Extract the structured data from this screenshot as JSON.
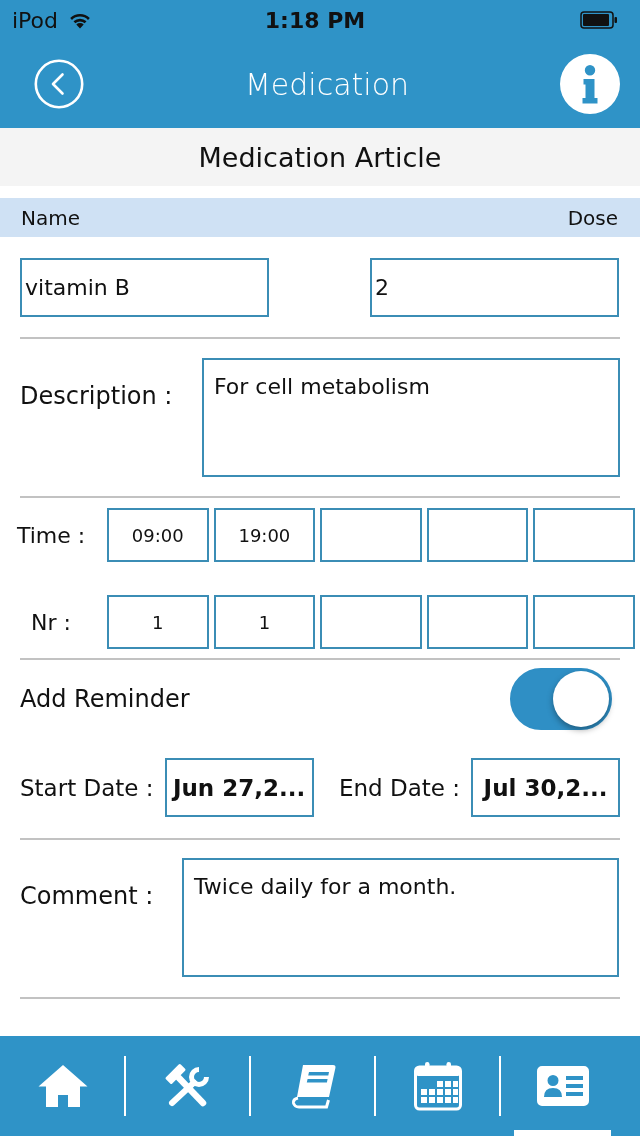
{
  "status_bar": {
    "carrier": "iPod",
    "time": "1:18 PM"
  },
  "nav_bar": {
    "title": "Medication"
  },
  "section": {
    "title": "Medication Article"
  },
  "columns": [
    "Name",
    "Dose"
  ],
  "medication": {
    "name": "vitamin B",
    "dose": "2"
  },
  "description": {
    "label": "Description :",
    "value": "For cell metabolism"
  },
  "schedule": [
    {
      "label": "Time :",
      "cells": [
        {
          "value": "09:00"
        },
        {
          "value": "19:00"
        },
        {},
        {},
        {}
      ]
    },
    {
      "label": "Nr :",
      "cells": [
        {
          "value": "1"
        },
        {
          "value": "1"
        },
        {},
        {},
        {}
      ]
    }
  ],
  "reminder": {
    "label": "Add Reminder",
    "on": true
  },
  "dates": [
    {
      "label": "Start Date :",
      "value": "Jun 27,2..."
    },
    {
      "label": "End Date :",
      "value": "Jul 30,2..."
    }
  ],
  "comment": {
    "label": "Comment :",
    "value": "Twice daily for a month."
  },
  "tab_bar": {
    "tabs": [
      {
        "kind": "home",
        "selected": false
      },
      {
        "kind": "tools",
        "selected": false
      },
      {
        "kind": "book",
        "selected": false
      },
      {
        "kind": "calendar",
        "selected": false
      },
      {
        "kind": "contact",
        "selected": true
      }
    ]
  }
}
